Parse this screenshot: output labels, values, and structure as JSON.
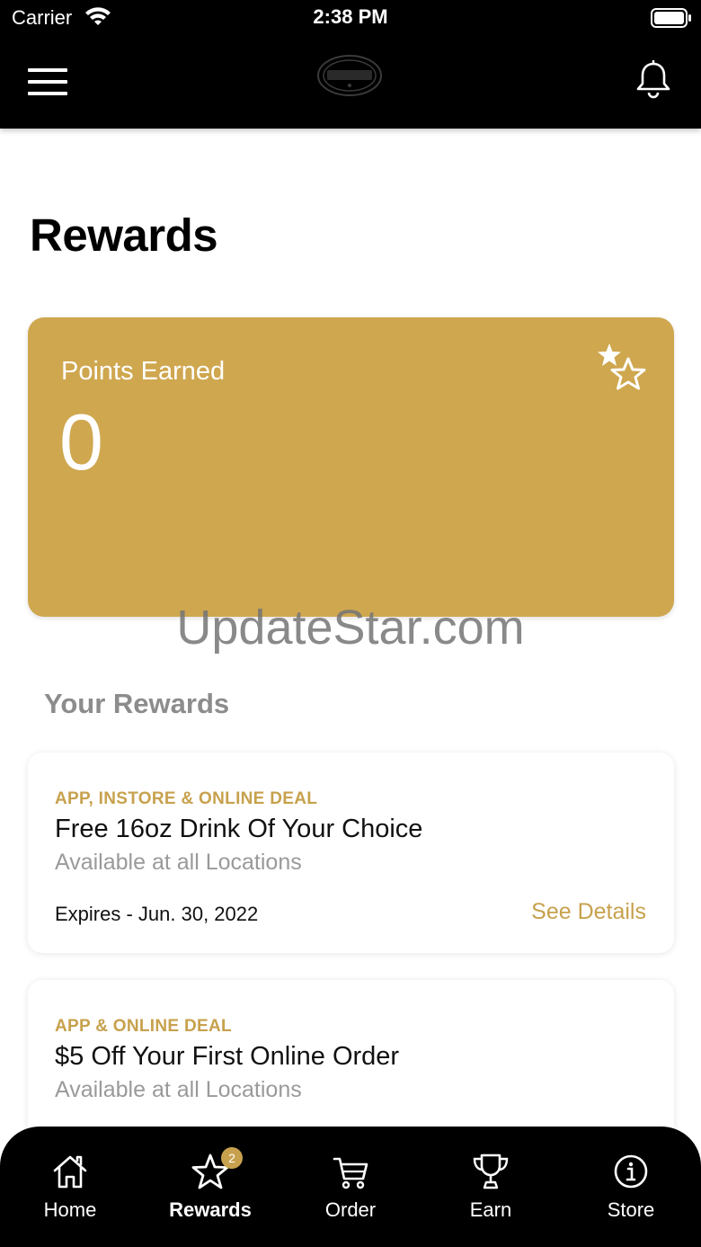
{
  "status_bar": {
    "carrier": "Carrier",
    "time": "2:38 PM"
  },
  "header": {
    "logo_alt": "The CREAMERY"
  },
  "page": {
    "title": "Rewards"
  },
  "points_card": {
    "label": "Points Earned",
    "value": "0",
    "color": "#cfa74f"
  },
  "watermark": "UpdateStar.com",
  "rewards_section": {
    "title": "Your Rewards",
    "items": [
      {
        "type": "APP, INSTORE & ONLINE DEAL",
        "title": "Free 16oz Drink Of Your Choice",
        "subtitle": "Available at all Locations",
        "expires": "Expires - Jun. 30, 2022",
        "details_label": "See Details"
      },
      {
        "type": "APP & ONLINE DEAL",
        "title": "$5 Off Your First Online Order",
        "subtitle": "Available at all Locations"
      }
    ]
  },
  "tabbar": {
    "tabs": [
      {
        "label": "Home",
        "icon": "home-icon"
      },
      {
        "label": "Rewards",
        "icon": "star-icon",
        "badge": "2",
        "active": true
      },
      {
        "label": "Order",
        "icon": "cart-icon"
      },
      {
        "label": "Earn",
        "icon": "trophy-icon"
      },
      {
        "label": "Store",
        "icon": "info-icon"
      }
    ]
  },
  "colors": {
    "accent": "#c7a14d",
    "header": "#000000"
  }
}
